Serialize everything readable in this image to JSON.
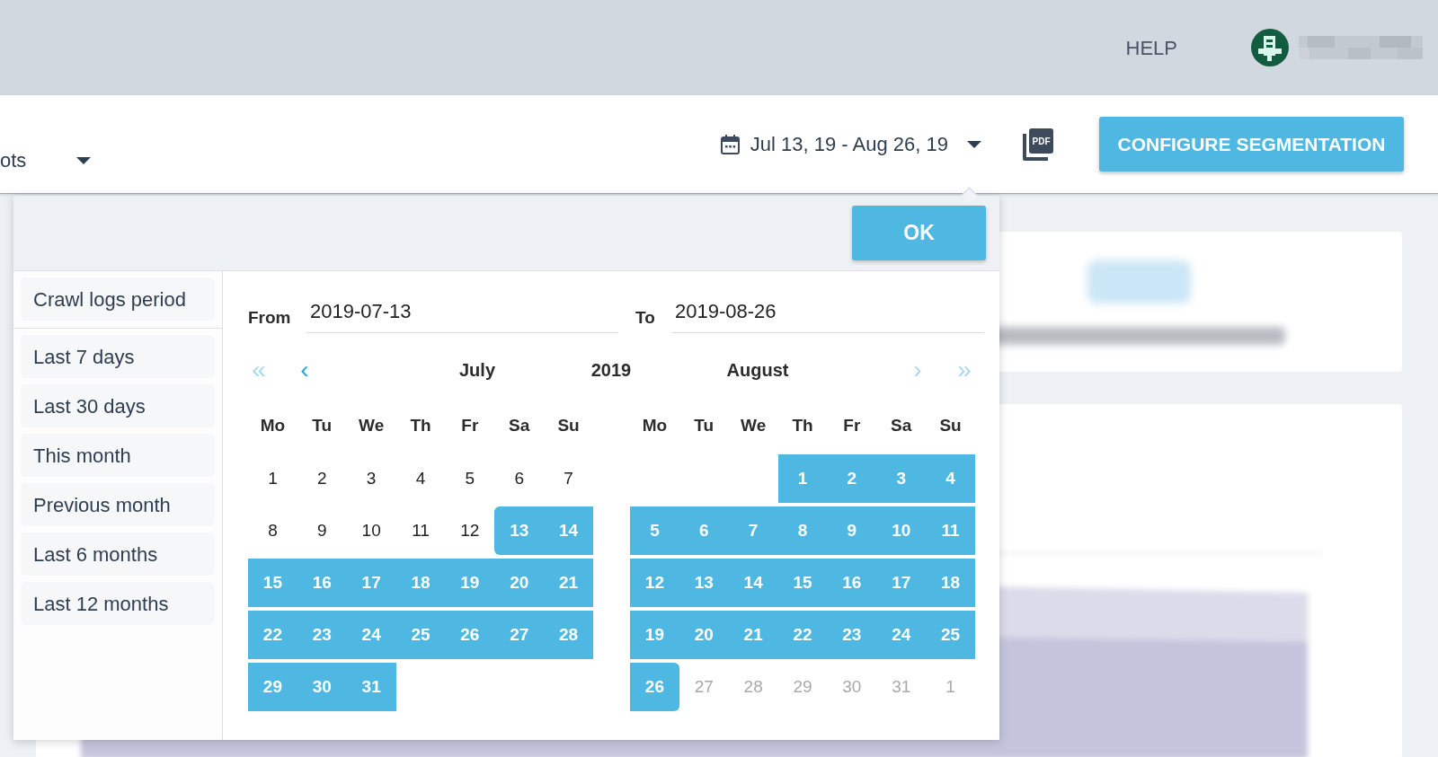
{
  "top_bar": {
    "help_link": "HELP"
  },
  "toolbar": {
    "view_select": {
      "value": "ots"
    },
    "date_range": {
      "label": "Jul 13, 19 - Aug 26, 19",
      "expanded": true
    },
    "pdf_button": {
      "label": "PDF"
    },
    "configure_button": "CONFIGURE SEGMENTATION"
  },
  "date_picker": {
    "ok_button": "OK",
    "period_presets": [
      {
        "label": "Crawl logs period",
        "selected": false
      }
    ],
    "presets": [
      {
        "label": "Last 7 days",
        "selected": false
      },
      {
        "label": "Last 30 days",
        "selected": false
      },
      {
        "label": "This month",
        "selected": false
      },
      {
        "label": "Previous month",
        "selected": false
      },
      {
        "label": "Last 6 months",
        "selected": false
      },
      {
        "label": "Last 12 months",
        "selected": false
      }
    ],
    "from": {
      "label": "From",
      "value": "2019-07-13"
    },
    "to": {
      "label": "To",
      "value": "2019-08-26"
    },
    "nav": [
      {
        "text": "«",
        "disabled": true
      },
      {
        "text": "‹",
        "disabled": false
      },
      {
        "text": "›",
        "disabled": true
      },
      {
        "text": "»",
        "disabled": true
      }
    ],
    "year": "2019",
    "months": [
      {
        "name": "July",
        "weekdays": [
          "Mo",
          "Tu",
          "We",
          "Th",
          "Fr",
          "Sa",
          "Su"
        ],
        "weeks": [
          [
            {
              "day": "1",
              "kind": "plain"
            },
            {
              "day": "2",
              "kind": "plain"
            },
            {
              "day": "3",
              "kind": "plain"
            },
            {
              "day": "4",
              "kind": "plain"
            },
            {
              "day": "5",
              "kind": "plain"
            },
            {
              "day": "6",
              "kind": "plain"
            },
            {
              "day": "7",
              "kind": "plain"
            }
          ],
          [
            {
              "day": "8",
              "kind": "plain"
            },
            {
              "day": "9",
              "kind": "plain"
            },
            {
              "day": "10",
              "kind": "plain"
            },
            {
              "day": "11",
              "kind": "plain"
            },
            {
              "day": "12",
              "kind": "plain"
            },
            {
              "day": "13",
              "kind": "range_start"
            },
            {
              "day": "14",
              "kind": "range"
            }
          ],
          [
            {
              "day": "15",
              "kind": "range"
            },
            {
              "day": "16",
              "kind": "range"
            },
            {
              "day": "17",
              "kind": "range"
            },
            {
              "day": "18",
              "kind": "range"
            },
            {
              "day": "19",
              "kind": "range"
            },
            {
              "day": "20",
              "kind": "range"
            },
            {
              "day": "21",
              "kind": "range"
            }
          ],
          [
            {
              "day": "22",
              "kind": "range"
            },
            {
              "day": "23",
              "kind": "range"
            },
            {
              "day": "24",
              "kind": "range"
            },
            {
              "day": "25",
              "kind": "range"
            },
            {
              "day": "26",
              "kind": "range"
            },
            {
              "day": "27",
              "kind": "range"
            },
            {
              "day": "28",
              "kind": "range"
            }
          ],
          [
            {
              "day": "29",
              "kind": "range"
            },
            {
              "day": "30",
              "kind": "range"
            },
            {
              "day": "31",
              "kind": "range"
            }
          ]
        ]
      },
      {
        "name": "August",
        "weekdays": [
          "Mo",
          "Tu",
          "We",
          "Th",
          "Fr",
          "Sa",
          "Su"
        ],
        "weeks": [
          [
            {
              "kind": "blank"
            },
            {
              "kind": "blank"
            },
            {
              "kind": "blank"
            },
            {
              "day": "1",
              "kind": "range"
            },
            {
              "day": "2",
              "kind": "range"
            },
            {
              "day": "3",
              "kind": "range"
            },
            {
              "day": "4",
              "kind": "range"
            }
          ],
          [
            {
              "day": "5",
              "kind": "range"
            },
            {
              "day": "6",
              "kind": "range"
            },
            {
              "day": "7",
              "kind": "range"
            },
            {
              "day": "8",
              "kind": "range"
            },
            {
              "day": "9",
              "kind": "range"
            },
            {
              "day": "10",
              "kind": "range"
            },
            {
              "day": "11",
              "kind": "range"
            }
          ],
          [
            {
              "day": "12",
              "kind": "range"
            },
            {
              "day": "13",
              "kind": "range"
            },
            {
              "day": "14",
              "kind": "range"
            },
            {
              "day": "15",
              "kind": "range"
            },
            {
              "day": "16",
              "kind": "range"
            },
            {
              "day": "17",
              "kind": "range"
            },
            {
              "day": "18",
              "kind": "range"
            }
          ],
          [
            {
              "day": "19",
              "kind": "range"
            },
            {
              "day": "20",
              "kind": "range"
            },
            {
              "day": "21",
              "kind": "range"
            },
            {
              "day": "22",
              "kind": "range"
            },
            {
              "day": "23",
              "kind": "range"
            },
            {
              "day": "24",
              "kind": "range"
            },
            {
              "day": "25",
              "kind": "range"
            }
          ],
          [
            {
              "day": "26",
              "kind": "range_end"
            },
            {
              "day": "27",
              "kind": "disabled"
            },
            {
              "day": "28",
              "kind": "disabled"
            },
            {
              "day": "29",
              "kind": "disabled"
            },
            {
              "day": "30",
              "kind": "disabled"
            },
            {
              "day": "31",
              "kind": "disabled"
            },
            {
              "day": "1",
              "kind": "disabled"
            }
          ]
        ]
      }
    ]
  }
}
